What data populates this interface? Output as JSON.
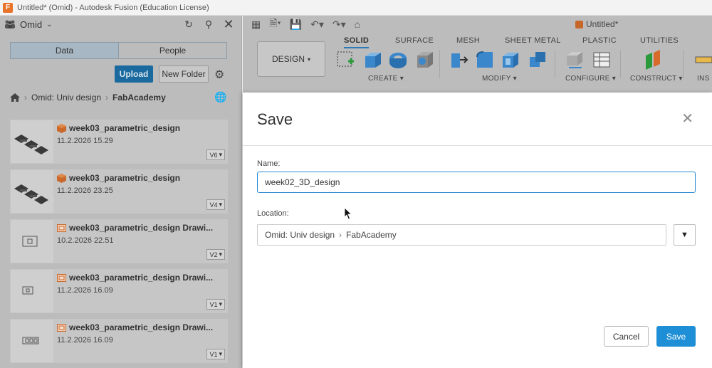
{
  "window": {
    "title": "Untitled* (Omid) - Autodesk Fusion (Education License)"
  },
  "data_panel": {
    "team": "Omid",
    "tabs": [
      "Data",
      "People"
    ],
    "upload_label": "Upload",
    "new_folder_label": "New Folder",
    "breadcrumb": [
      "Omid: Univ design",
      "FabAcademy"
    ],
    "files": [
      {
        "name": "week03_parametric_design",
        "date": "11.2.2026 15.29",
        "version": "V6",
        "type": "design"
      },
      {
        "name": "week03_parametric_design",
        "date": "11.2.2026 23.25",
        "version": "V4",
        "type": "design"
      },
      {
        "name": "week03_parametric_design Drawi...",
        "date": "10.2.2026 22.51",
        "version": "V2",
        "type": "drawing"
      },
      {
        "name": "week03_parametric_design Drawi...",
        "date": "11.2.2026 16.09",
        "version": "V1",
        "type": "drawing"
      },
      {
        "name": "week03_parametric_design Drawi...",
        "date": "11.2.2026 16.09",
        "version": "V1",
        "type": "drawing"
      }
    ]
  },
  "document_tab": {
    "title": "Untitled*"
  },
  "ribbon": {
    "workspace_label": "DESIGN",
    "tabs": [
      "SOLID",
      "SURFACE",
      "MESH",
      "SHEET METAL",
      "PLASTIC",
      "UTILITIES"
    ],
    "active_tab": "SOLID",
    "groups": [
      "CREATE",
      "MODIFY",
      "CONFIGURE",
      "CONSTRUCT",
      "INS"
    ]
  },
  "dialog": {
    "title": "Save",
    "name_label": "Name:",
    "name_value": "week02_3D_design",
    "location_label": "Location:",
    "location_path": [
      "Omid: Univ design",
      "FabAcademy"
    ],
    "cancel_label": "Cancel",
    "save_label": "Save"
  },
  "colors": {
    "primary_button": "#1e8fd6",
    "input_focus_border": "#2a8ad4",
    "design_file_icon": "#e8732a",
    "overlay_dim": "#bcbcbc"
  }
}
